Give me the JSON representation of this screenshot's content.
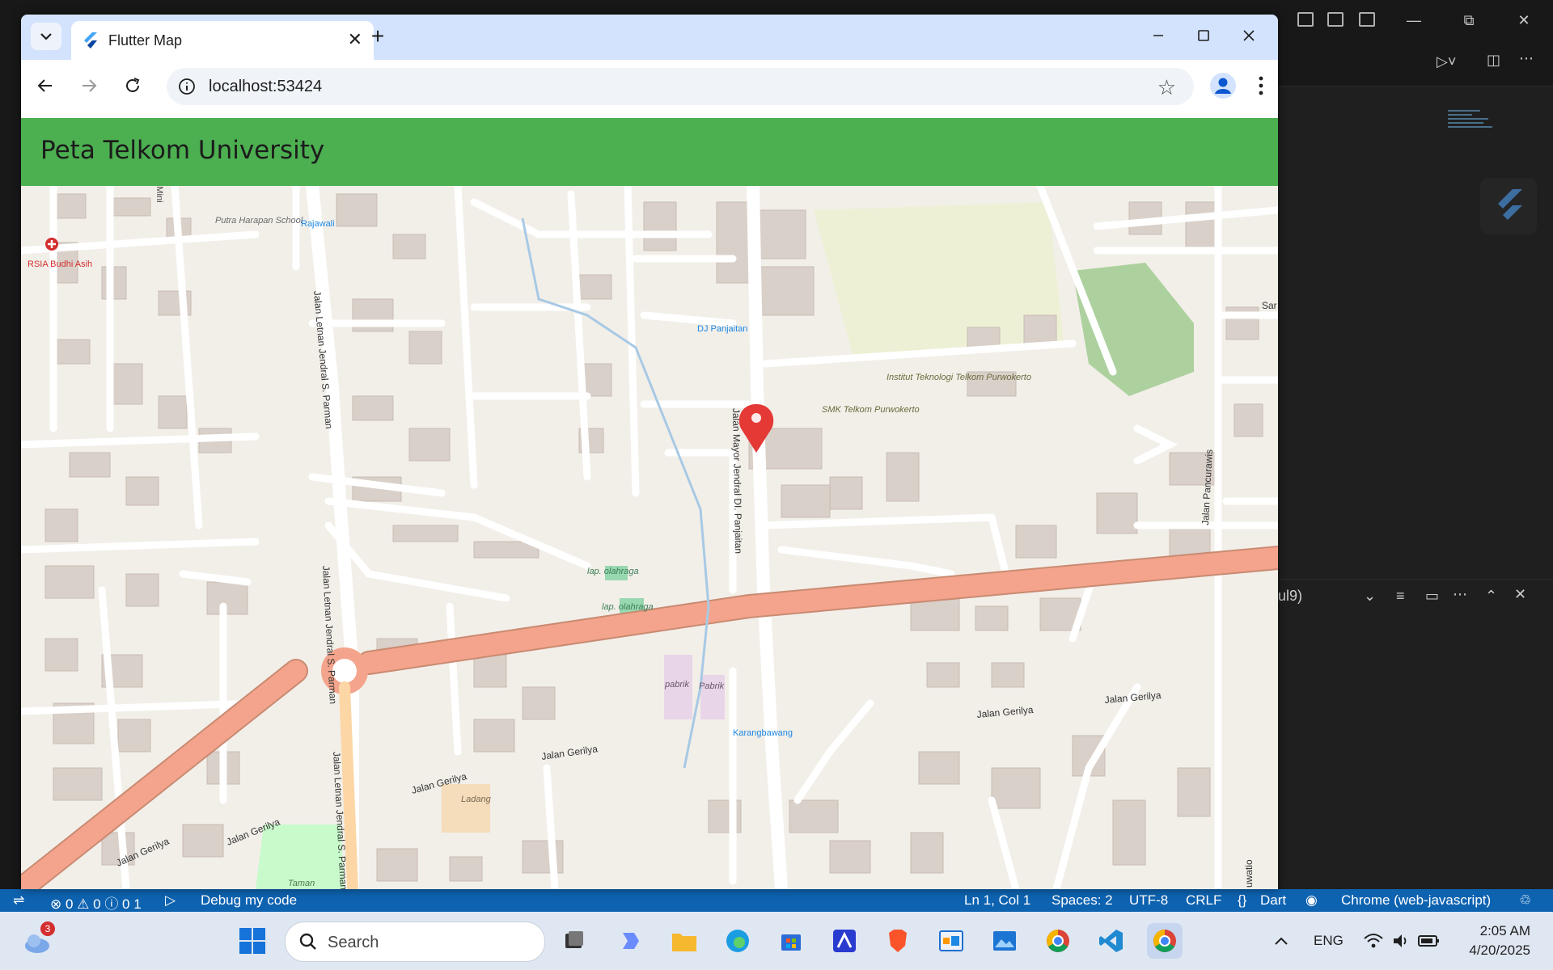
{
  "vscode": {
    "panel_dropdown_text": "ul9)",
    "statusbar": {
      "problems_errors": "0",
      "problems_warnings": "0",
      "problems_info": "0",
      "ports": "1",
      "debug_label": "Debug my code",
      "cursor_position": "Ln 1, Col 1",
      "spaces": "Spaces: 2",
      "encoding": "UTF-8",
      "line_endings": "CRLF",
      "language": "Dart",
      "target_device": "Chrome (web-javascript)"
    }
  },
  "browser": {
    "tab_title": "Flutter Map",
    "url": "localhost:53424"
  },
  "app": {
    "title": "Peta Telkom University"
  },
  "map": {
    "marker_color": "#e53935",
    "labels": {
      "rsia": "RSIA Budhi Asih",
      "school": "Putra Harapan School",
      "stadion": "Stadion Mini",
      "rajawali": "Rajawali",
      "dj_panjaitan": "DJ Panjaitan",
      "institut": "Institut Teknologi Telkom Purwokerto",
      "smk": "SMK Telkom Purwokerto",
      "sparman_1": "Jalan Letnan Jendral S. Parman",
      "sparman_2": "Jalan Letnan Jendral S. Parman",
      "sparman_3": "Jalan Letnan Jendral S. Parman",
      "panjaitan_road": "Jalan Mayor Jendral DI. Panjaitan",
      "pancurawis": "Jalan Pancurawis",
      "lap1": "lap. olahraga",
      "lap2": "lap. olahraga",
      "pabrik1": "pabrik",
      "pabrik2": "Pabrik",
      "karangbawang": "Karangbawang",
      "ladang": "Ladang",
      "taman": "Taman",
      "gerilya_1": "Jalan Gerilya",
      "gerilya_2": "Jalan Gerilya",
      "gerilya_3": "Jalan Gerilya",
      "gerilya_4": "Jalan Gerilya",
      "gerilya_5": "Jalan Gerilya",
      "gerilya_6": "Jalan Gerilya",
      "sar_edge": "Sar",
      "uwatio_edge": "uwatio"
    }
  },
  "taskbar": {
    "weather_badge": "3",
    "search_placeholder": "Search",
    "language": "ENG",
    "time": "2:05 AM",
    "date": "4/20/2025"
  }
}
